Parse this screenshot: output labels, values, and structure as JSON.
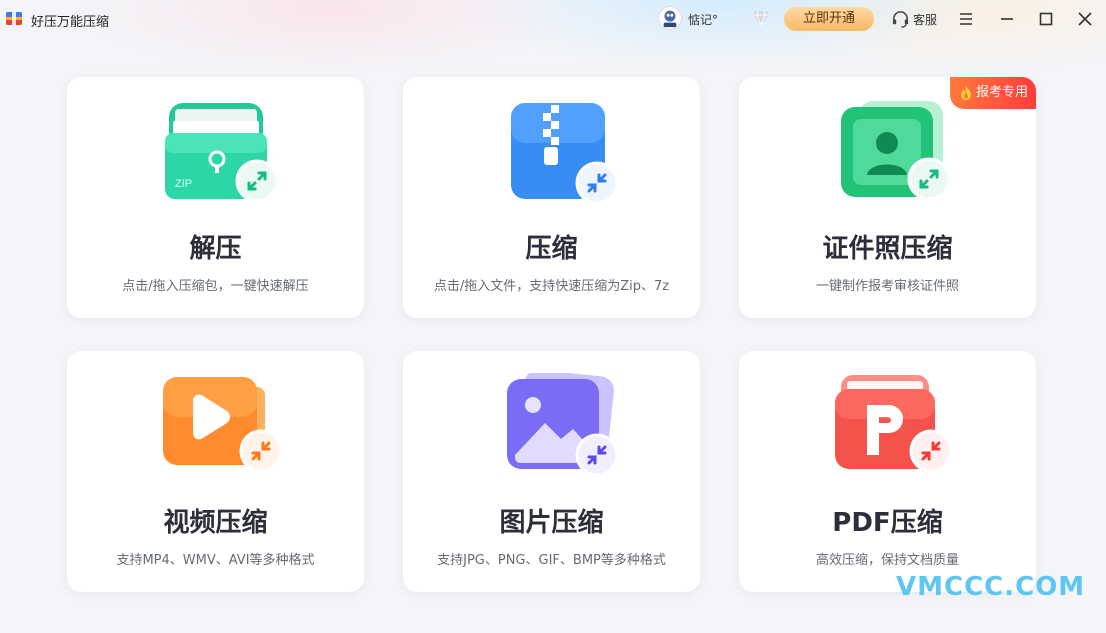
{
  "app": {
    "title": "好压万能压缩"
  },
  "user": {
    "name": "惦记°"
  },
  "header": {
    "vip_label": "立即开通",
    "service_label": "客服"
  },
  "cards": [
    {
      "title": "解压",
      "desc": "点击/拖入压缩包，一键快速解压",
      "icon": "zip-folder-icon"
    },
    {
      "title": "压缩",
      "desc": "点击/拖入文件，支持快速压缩为Zip、7z",
      "icon": "zipper-file-icon"
    },
    {
      "title": "证件照压缩",
      "desc": "一键制作报考审核证件照",
      "icon": "id-photo-icon",
      "badge": "报考专用"
    },
    {
      "title": "视频压缩",
      "desc": "支持MP4、WMV、AVI等多种格式",
      "icon": "video-icon"
    },
    {
      "title": "图片压缩",
      "desc": "支持JPG、PNG、GIF、BMP等多种格式",
      "icon": "image-icon"
    },
    {
      "title": "PDF压缩",
      "desc": "高效压缩，保持文档质量",
      "icon": "pdf-icon"
    }
  ],
  "watermark": "VMCCC.COM",
  "colors": {
    "vip_gold": "#f9b866",
    "badge_red": "#ff3b3b",
    "watermark_blue": "#5ec6f2"
  }
}
